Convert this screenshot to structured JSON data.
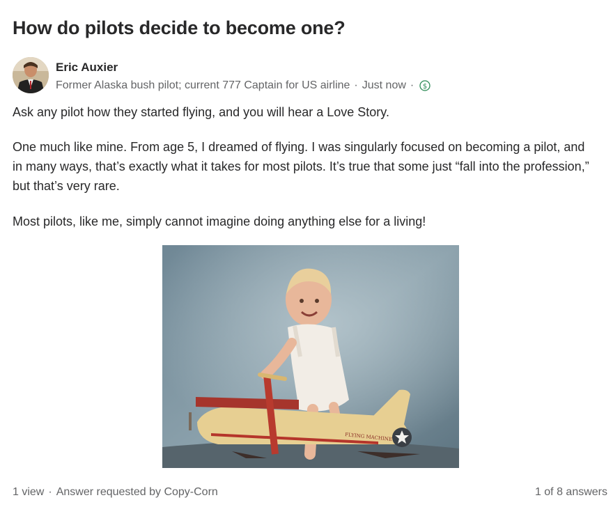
{
  "question": {
    "title": "How do pilots decide to become one?"
  },
  "author": {
    "name": "Eric Auxier",
    "credential": "Former Alaska bush pilot; current 777 Captain for US airline",
    "separator": "·",
    "timestamp": "Just now",
    "avatar_icon": "author-avatar-photo",
    "monetized_icon": "dollar-circle-icon",
    "monetized_color": "#2e8b57"
  },
  "answer": {
    "paragraphs": [
      "Ask any pilot how they started flying, and you will hear a Love Story.",
      "One much like mine. From age 5, I dreamed of flying. I was singularly focused on becoming a pilot, and in many ways, that’s exactly what it takes for most pilots. It’s true that some just “fall into the profession,” but that’s very rare.",
      "Most pilots, like me, simply cannot imagine doing anything else for a living!"
    ],
    "image_caption_text": "FLYING MACHINE"
  },
  "footer": {
    "views": "1 view",
    "separator": "·",
    "requested_by": "Answer requested by Copy-Corn",
    "answer_position": "1 of 8 answers"
  }
}
